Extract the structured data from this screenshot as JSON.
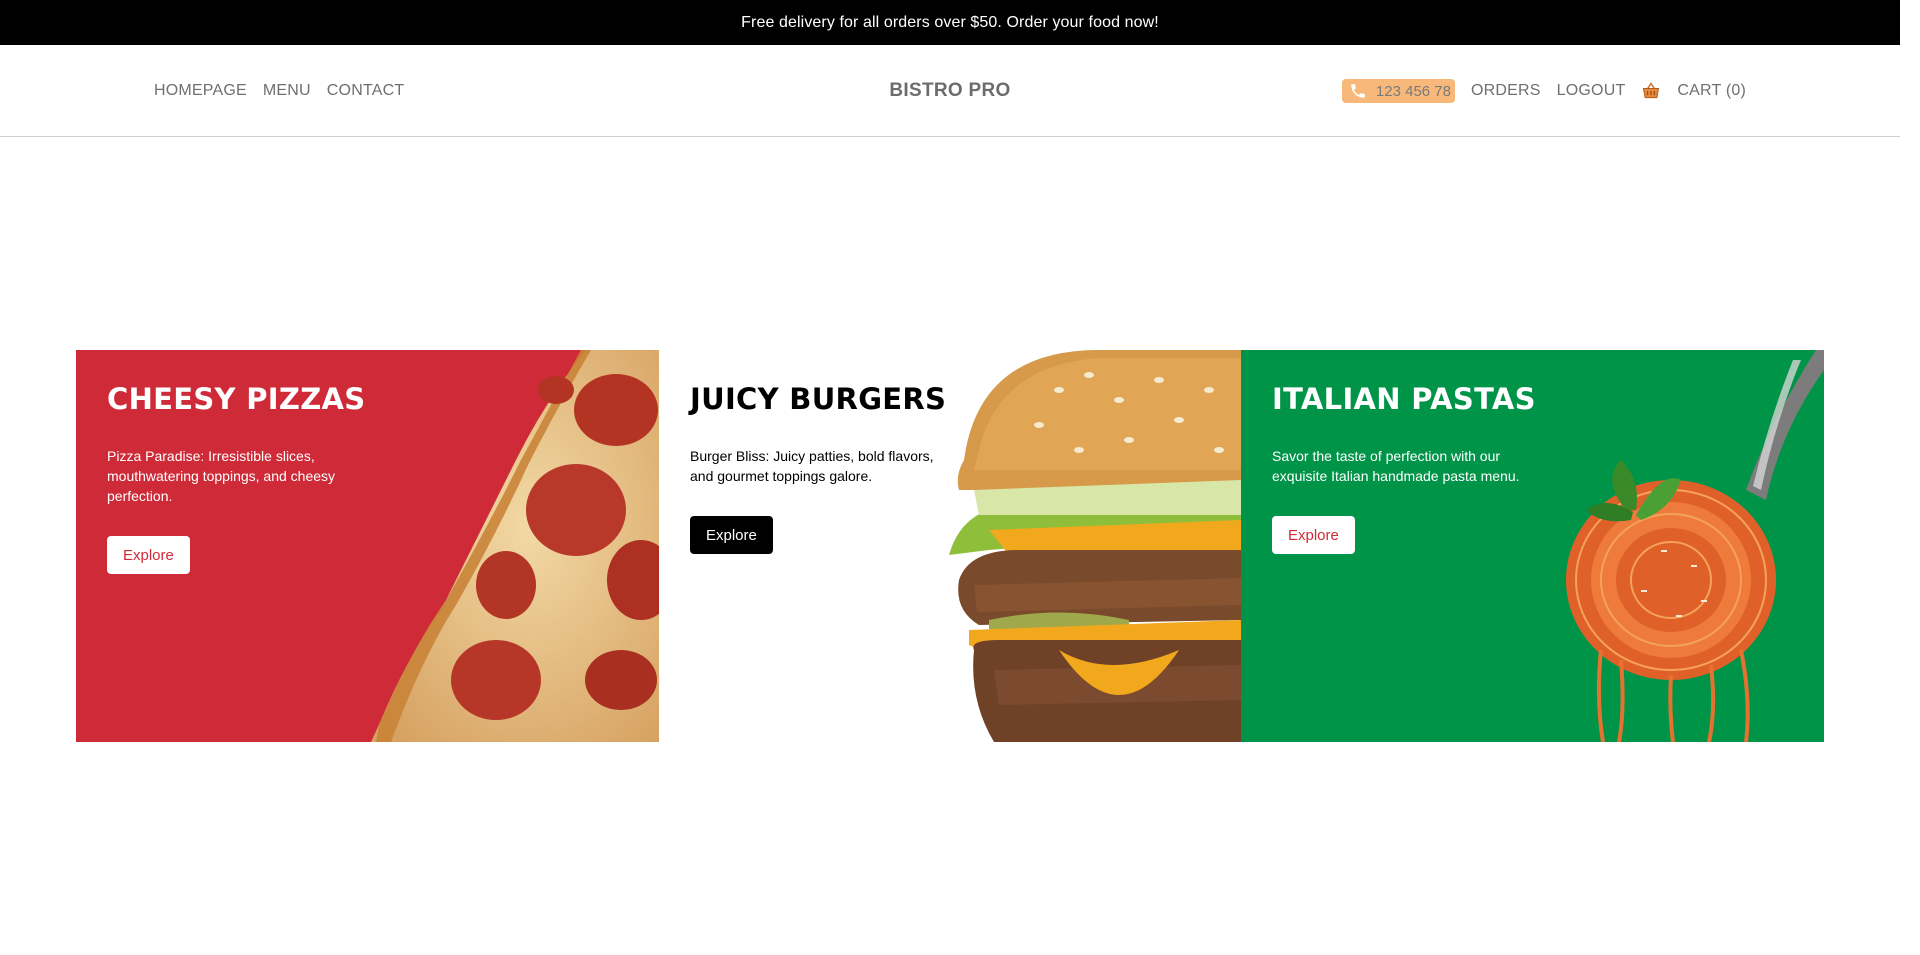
{
  "announcement": "Free delivery for all orders over $50. Order your food now!",
  "nav": {
    "left": [
      "HOMEPAGE",
      "MENU",
      "CONTACT"
    ],
    "brand": "BISTRO PRO",
    "phone": "123 456 78",
    "orders": "ORDERS",
    "logout": "LOGOUT",
    "cart": "CART (0)"
  },
  "cards": [
    {
      "title": "CHEESY PIZZAS",
      "description": "Pizza Paradise: Irresistible slices, mouthwatering toppings, and cheesy perfection.",
      "button": "Explore",
      "bg": "#cf2a37"
    },
    {
      "title": "JUICY BURGERS",
      "description": "Burger Bliss: Juicy patties, bold flavors, and gourmet toppings galore.",
      "button": "Explore",
      "bg": "#ffffff"
    },
    {
      "title": "ITALIAN PASTAS",
      "description": "Savor the taste of perfection with our exquisite Italian handmade pasta menu.",
      "button": "Explore",
      "bg": "#009448"
    }
  ],
  "colors": {
    "accent_red": "#cf2a37",
    "accent_green": "#009448",
    "phone_pill": "#f7b87a"
  },
  "icons": {
    "phone": "phone-icon",
    "cart": "basket-icon"
  }
}
